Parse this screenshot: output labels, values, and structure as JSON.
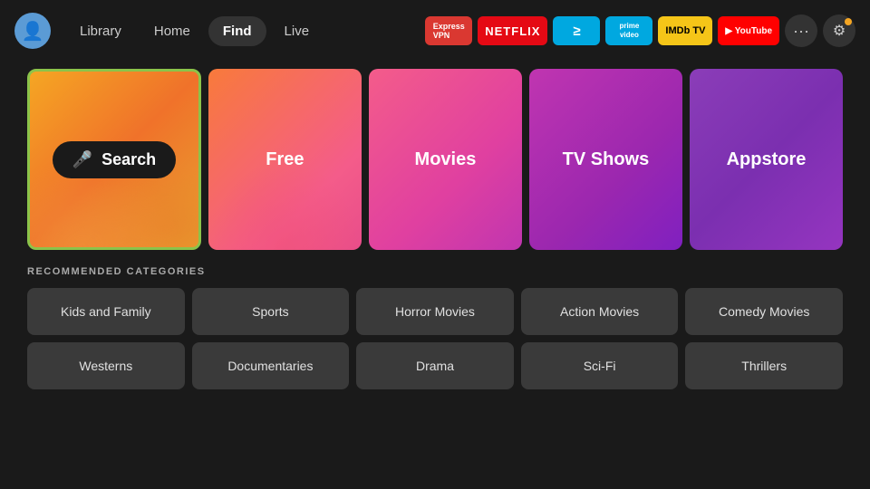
{
  "header": {
    "nav": {
      "library": "Library",
      "home": "Home",
      "find": "Find",
      "live": "Live"
    },
    "apps": [
      {
        "id": "expressvpn",
        "label": "ExpressVPN",
        "class": "badge-expressvpn"
      },
      {
        "id": "netflix",
        "label": "NETFLIX",
        "class": "badge-netflix"
      },
      {
        "id": "freevee",
        "label": "≥",
        "class": "badge-freevee"
      },
      {
        "id": "prime",
        "label": "prime video",
        "class": "badge-prime"
      },
      {
        "id": "imdb",
        "label": "IMDb TV",
        "class": "badge-imdb"
      },
      {
        "id": "youtube",
        "label": "▶ YouTube",
        "class": "badge-youtube"
      }
    ]
  },
  "tiles": [
    {
      "id": "search",
      "label": "Search",
      "type": "search"
    },
    {
      "id": "free",
      "label": "Free",
      "type": "free"
    },
    {
      "id": "movies",
      "label": "Movies",
      "type": "movies"
    },
    {
      "id": "tvshows",
      "label": "TV Shows",
      "type": "tvshows"
    },
    {
      "id": "appstore",
      "label": "Appstore",
      "type": "appstore"
    }
  ],
  "categories": {
    "title": "RECOMMENDED CATEGORIES",
    "items": [
      "Kids and Family",
      "Sports",
      "Horror Movies",
      "Action Movies",
      "Comedy Movies",
      "Westerns",
      "Documentaries",
      "Drama",
      "Sci-Fi",
      "Thrillers"
    ]
  },
  "icons": {
    "mic": "🎤",
    "more": "···",
    "settings": "⚙"
  }
}
